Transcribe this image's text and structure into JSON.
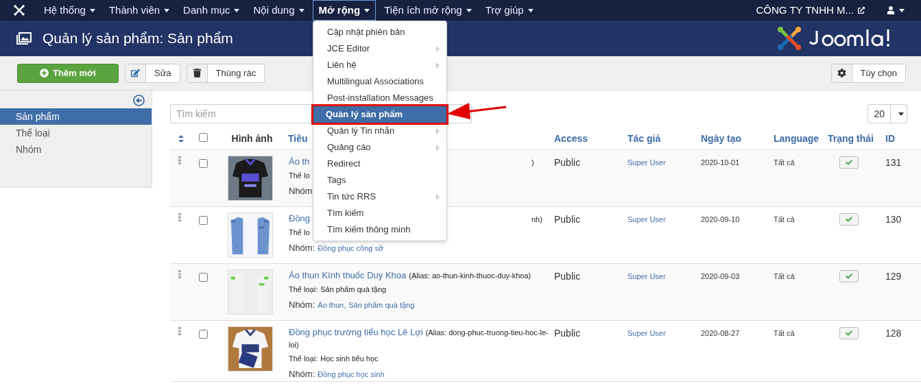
{
  "navbar": {
    "menus": [
      {
        "label": "Hệ thống",
        "selected": false
      },
      {
        "label": "Thành viên",
        "selected": false
      },
      {
        "label": "Danh mục",
        "selected": false
      },
      {
        "label": "Nội dung",
        "selected": false
      },
      {
        "label": "Mở rộng",
        "selected": true
      },
      {
        "label": "Tiện ích mở rộng",
        "selected": false
      },
      {
        "label": "Trợ giúp",
        "selected": false
      }
    ],
    "site_link": "CÔNG TY TNHH M..."
  },
  "header": {
    "title": "Quản lý sản phẩm: Sản phẩm"
  },
  "toolbar": {
    "buttons": [
      {
        "label": "Thêm mới",
        "kind": "new"
      },
      {
        "label": "Sửa",
        "kind": "edit"
      },
      {
        "label": "Thùng rác",
        "kind": "trash"
      }
    ],
    "options": "Tùy chọn"
  },
  "sidebar": {
    "items": [
      {
        "label": "Sản phẩm",
        "selected": true
      },
      {
        "label": "Thể loại",
        "selected": false
      },
      {
        "label": "Nhóm",
        "selected": false
      }
    ]
  },
  "search": {
    "placeholder": "Tìm kiếm"
  },
  "select_all": {
    "checked": false
  },
  "limit": "20",
  "table": {
    "columns": [
      "Hình ảnh",
      "Tiêu",
      "Access",
      "Tác giả",
      "Ngày tạo",
      "Language",
      "Trạng thái",
      "ID"
    ],
    "rows": [
      {
        "checked": false,
        "title": "Áo th",
        "title_tail": ")",
        "category_label": "Thể lo",
        "group_label": "Nhóm",
        "groups": [],
        "access": "Public",
        "author": "Super User",
        "date": "2020-10-01",
        "language": "Tất cả",
        "published": true,
        "id": "131"
      },
      {
        "checked": false,
        "title": "Đồng",
        "title_tail": "nh)",
        "category_label": "Thể lo",
        "group_label": "Nhóm:",
        "groups": [
          "Đồng phục công sở"
        ],
        "access": "Public",
        "author": "Super User",
        "date": "2020-09-10",
        "language": "Tất cả",
        "published": true,
        "id": "130"
      },
      {
        "checked": false,
        "title": "Áo thun Kính thuốc Duy Khoa",
        "alias": "(Alias: ao-thun-kinh-thuoc-duy-khoa)",
        "category_label": "Thể loại:",
        "category": "Sản phẩm quà tặng",
        "group_label": "Nhóm:",
        "groups": [
          "Áo thun,",
          "Sản phẩm quà tặng"
        ],
        "access": "Public",
        "author": "Super User",
        "date": "2020-09-03",
        "language": "Tất cả",
        "published": true,
        "id": "129"
      },
      {
        "checked": false,
        "title": "Đồng phục trường tiểu học Lê Lợi",
        "alias": "(Alias: dong-phuc-truong-tieu-hoc-le-loi)",
        "category_label": "Thể loại:",
        "category": "Học sinh tiểu học",
        "group_label": "Nhóm:",
        "groups": [
          "Đồng phục học sinh"
        ],
        "access": "Public",
        "author": "Super User",
        "date": "2020-08-27",
        "language": "Tất cả",
        "published": true,
        "id": "128"
      }
    ]
  },
  "dropdown": {
    "items": [
      {
        "label": "Cập nhật phiên bản",
        "submenu": false,
        "selected": false
      },
      {
        "label": "JCE Editor",
        "submenu": true,
        "selected": false
      },
      {
        "label": "Liên hệ",
        "submenu": true,
        "selected": false
      },
      {
        "label": "Multilingual Associations",
        "submenu": false,
        "selected": false
      },
      {
        "label": "Post-installation Messages",
        "submenu": false,
        "selected": false
      },
      {
        "label": "Quản lý sản phẩm",
        "submenu": false,
        "selected": true
      },
      {
        "label": "Quản lý Tin nhắn",
        "submenu": true,
        "selected": false
      },
      {
        "label": "Quảng cáo",
        "submenu": true,
        "selected": false
      },
      {
        "label": "Redirect",
        "submenu": false,
        "selected": false
      },
      {
        "label": "Tags",
        "submenu": false,
        "selected": false
      },
      {
        "label": "Tin tức RRS",
        "submenu": true,
        "selected": false
      },
      {
        "label": "Tìm kiếm",
        "submenu": false,
        "selected": false
      },
      {
        "label": "Tìm kiếm thông minh",
        "submenu": false,
        "selected": false
      }
    ]
  }
}
